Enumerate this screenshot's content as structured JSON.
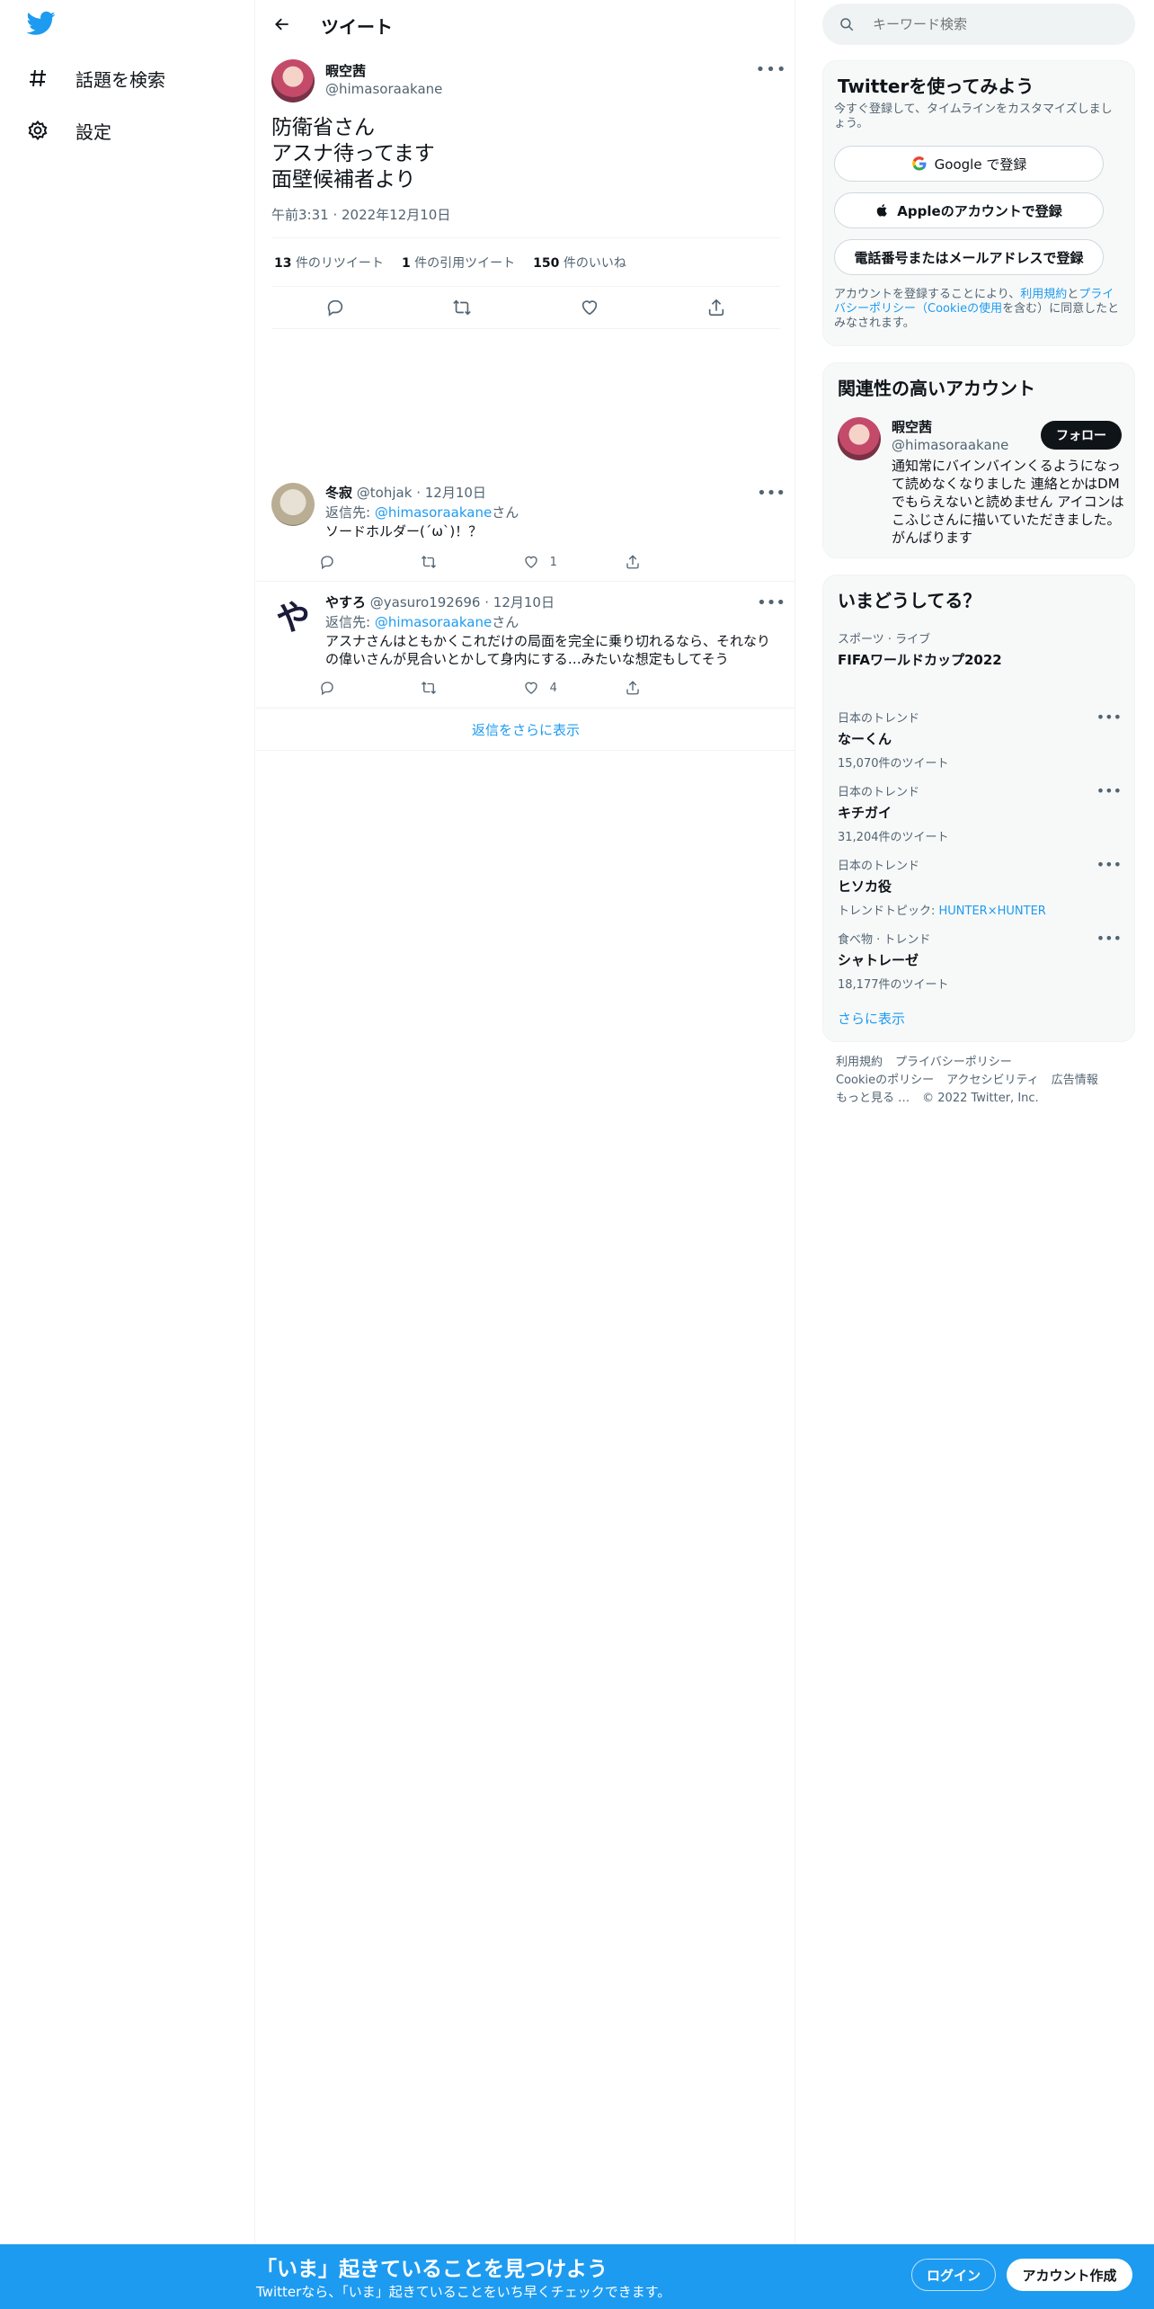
{
  "brand": {
    "accent": "#1d9bf0",
    "logo_icon": "twitter-bird-icon"
  },
  "nav": {
    "items": [
      {
        "label": "話題を検索",
        "icon": "hashtag-icon"
      },
      {
        "label": "設定",
        "icon": "gear-icon"
      }
    ]
  },
  "main": {
    "title": "ツイート",
    "tweet": {
      "name": "暇空茜",
      "handle": "@himasoraakane",
      "text": "防衛省さん\nアスナ待ってます\n面壁候補者より",
      "time": "午前3:31 · 2022年12月10日",
      "stats": {
        "retweets_count": "13",
        "retweets_label": "件のリツイート",
        "quotes_count": "1",
        "quotes_label": "件の引用ツイート",
        "likes_count": "150",
        "likes_label": "件のいいね"
      }
    },
    "replies": [
      {
        "name": "冬寂",
        "handle": "@tohjak",
        "date": "· 12月10日",
        "reply_to_prefix": "返信先: ",
        "reply_to_user": "@himasoraakane",
        "reply_to_suffix": "さん",
        "text": "ソードホルダー(´ω`)！？",
        "likes": "1"
      },
      {
        "name": "やすろ",
        "handle": "@yasuro192696",
        "date": "· 12月10日",
        "reply_to_prefix": "返信先: ",
        "reply_to_user": "@himasoraakane",
        "reply_to_suffix": "さん",
        "text": "アスナさんはともかくこれだけの局面を完全に乗り切れるなら、それなりの偉いさんが見合いとかして身内にする…みたいな想定もしてそう",
        "likes": "4",
        "avatar_char": "や"
      }
    ],
    "show_more": "返信をさらに表示"
  },
  "sidebar": {
    "search_placeholder": "キーワード検索",
    "signup": {
      "title": "Twitterを使ってみよう",
      "subtitle": "今すぐ登録して、タイムラインをカスタマイズしましょう。",
      "google_btn": "Google で登録",
      "apple_btn": "Appleのアカウントで登録",
      "phone_btn": "電話番号またはメールアドレスで登録",
      "terms_pre": "アカウントを登録することにより、",
      "terms_link1": "利用規約",
      "terms_mid1": "と",
      "terms_link2": "プライバシーポリシー（Cookieの使用",
      "terms_post": "を含む）に同意したとみなされます。"
    },
    "related": {
      "title": "関連性の高いアカウント",
      "name": "暇空茜",
      "handle": "@himasoraakane",
      "follow": "フォロー",
      "bio": "通知常にバインバインくるようになって読めなくなりました 連絡とかはDMでもらえないと読めません アイコンはこふじさんに描いていただきました。 がんばります"
    },
    "trends": {
      "title": "いまどうしてる？",
      "items": [
        {
          "category": "スポーツ · ライブ",
          "title": "FIFAワールドカップ2022",
          "count": ""
        },
        {
          "category": "日本のトレンド",
          "title": "なーくん",
          "count": "15,070件のツイート"
        },
        {
          "category": "日本のトレンド",
          "title": "キチガイ",
          "count": "31,204件のツイート"
        },
        {
          "category": "日本のトレンド",
          "title": "ヒソカ役",
          "count_prefix": "トレンドトピック: ",
          "count_link": "HUNTER×HUNTER"
        },
        {
          "category": "食べ物 · トレンド",
          "title": "シャトレーゼ",
          "count": "18,177件のツイート"
        }
      ],
      "show_more": "さらに表示"
    },
    "footer": {
      "links": [
        "利用規約",
        "プライバシーポリシー",
        "Cookieのポリシー",
        "アクセシビリティ",
        "広告情報",
        "もっと見る …",
        "© 2022 Twitter, Inc."
      ]
    }
  },
  "bottom_bar": {
    "title": "「いま」起きていることを見つけよう",
    "subtitle": "Twitterなら、「いま」起きていることをいち早くチェックできます。",
    "login": "ログイン",
    "signup": "アカウント作成"
  }
}
